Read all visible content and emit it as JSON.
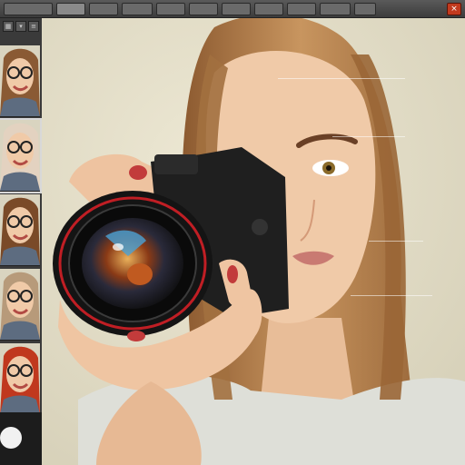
{
  "toolbar": {
    "buttons": [
      "",
      "",
      "",
      "",
      "",
      "",
      "",
      "",
      "",
      "",
      ""
    ],
    "close_label": "×"
  },
  "filmstrip": {
    "tools": [
      "",
      "",
      ""
    ],
    "thumbs": [
      {
        "label": "",
        "hair": "#8a5a34",
        "selected": false
      },
      {
        "label": "",
        "hair": "#e3d2c0",
        "selected": true
      },
      {
        "label": "",
        "hair": "#7a4a28",
        "selected": false
      },
      {
        "label": "",
        "hair": "#b79a7a",
        "selected": false
      },
      {
        "label": "",
        "hair": "#c0381e",
        "selected": false
      }
    ]
  },
  "canvas": {
    "camera_brand": "",
    "colors": {
      "background": "#e7e2cd",
      "hair": "#b07a4a",
      "skin": "#efc9a8",
      "shirt": "#dcdcd4",
      "camera": "#1e1e1e",
      "lens_ring": "#c01e24",
      "nails": "#c23b3b"
    }
  }
}
